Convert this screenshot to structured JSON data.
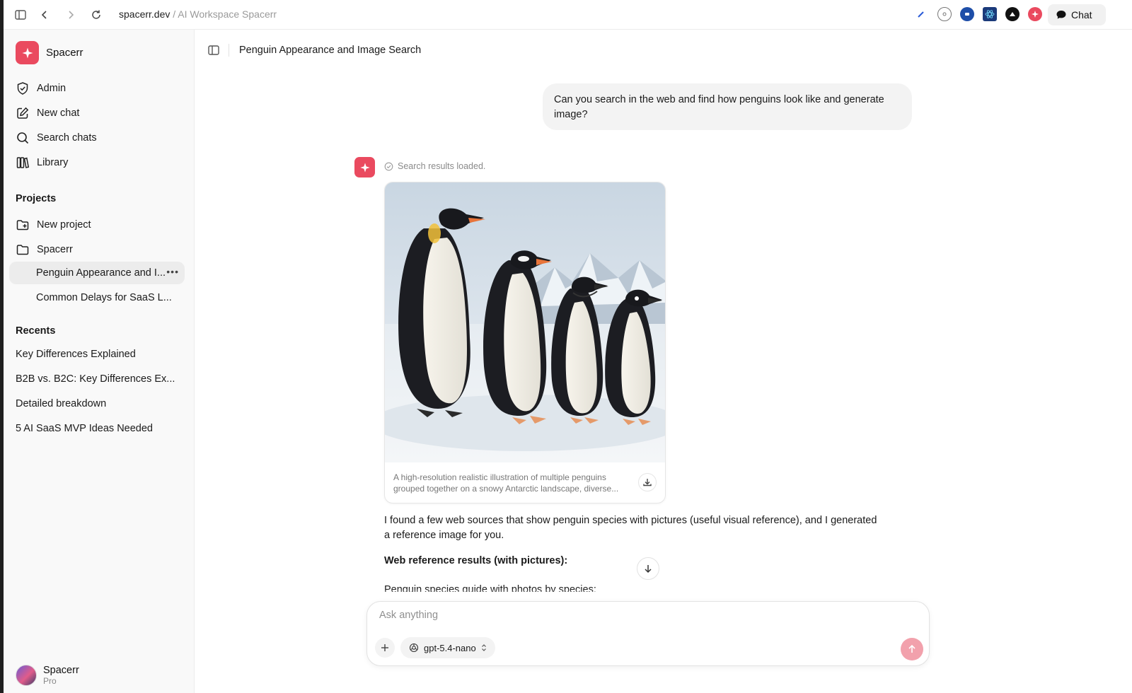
{
  "browser": {
    "url_host": "spacerr.dev",
    "url_rest": " / AI Workspace Spacerr",
    "chat_button_label": "Chat"
  },
  "sidebar": {
    "brand_name": "Spacerr",
    "nav": [
      {
        "label": "Admin",
        "icon": "shield-icon"
      },
      {
        "label": "New chat",
        "icon": "edit-icon"
      },
      {
        "label": "Search chats",
        "icon": "search-icon"
      },
      {
        "label": "Library",
        "icon": "library-icon"
      }
    ],
    "projects_title": "Projects",
    "projects": [
      {
        "label": "New project",
        "icon": "folder-plus-icon"
      },
      {
        "label": "Spacerr",
        "icon": "folder-icon"
      }
    ],
    "project_chats": [
      {
        "label": "Penguin Appearance and I...",
        "active": true
      },
      {
        "label": "Common Delays for SaaS L...",
        "active": false
      }
    ],
    "recents_title": "Recents",
    "recents": [
      "Key Differences Explained",
      "B2B vs. B2C: Key Differences Ex...",
      "Detailed breakdown",
      "5 AI SaaS MVP Ideas Needed"
    ],
    "user": {
      "name": "Spacerr",
      "plan": "Pro"
    }
  },
  "main": {
    "chat_title": "Penguin Appearance and Image Search",
    "user_message": "Can you search in the web and find how penguins look like and generate image?",
    "status": "Search results loaded.",
    "image_caption": "A high-resolution realistic illustration of multiple penguins grouped together on a snowy Antarctic landscape, diverse...",
    "reply_text": "I found a few web sources that show penguin species with pictures (useful visual reference), and I generated a reference image for you.",
    "reply_heading": "Web reference results (with pictures):",
    "reply_sub": "Penguin species guide with photos by species:"
  },
  "composer": {
    "placeholder": "Ask anything",
    "model": "gpt-5.4-nano"
  },
  "colors": {
    "accent": "#ea4a5f",
    "send_disabled": "#f2a1ac"
  }
}
